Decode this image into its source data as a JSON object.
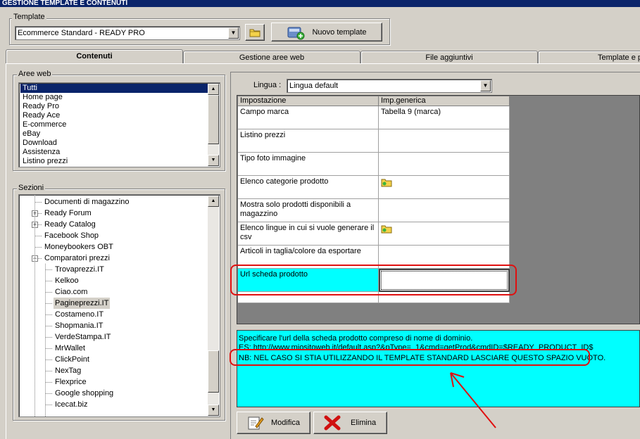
{
  "window": {
    "title": "GESTIONE TEMPLATE E CONTENUTI"
  },
  "template": {
    "group_label": "Template",
    "selected": "Ecommerce Standard - READY PRO",
    "new_button": "Nuovo template"
  },
  "tabs": [
    "Contenuti",
    "Gestione aree web",
    "File aggiuntivi",
    "Template e p"
  ],
  "aree_web": {
    "label": "Aree web",
    "items": [
      "Tutti",
      "Home page",
      "Ready Pro",
      "Ready Ace",
      "E-commerce",
      "eBay",
      "Download",
      "Assistenza",
      "Listino prezzi"
    ]
  },
  "sezioni": {
    "label": "Sezioni",
    "items": [
      {
        "label": "Documenti di magazzino",
        "expander": ""
      },
      {
        "label": "Ready Forum",
        "expander": "+"
      },
      {
        "label": "Ready Catalog",
        "expander": "+"
      },
      {
        "label": "Facebook Shop",
        "expander": ""
      },
      {
        "label": "Moneybookers OBT",
        "expander": ""
      },
      {
        "label": "Comparatori prezzi",
        "expander": "−"
      },
      {
        "label": "Trovaprezzi.IT",
        "expander": ""
      },
      {
        "label": "Kelkoo",
        "expander": ""
      },
      {
        "label": "Ciao.com",
        "expander": ""
      },
      {
        "label": "Pagineprezzi.IT",
        "expander": ""
      },
      {
        "label": "Costameno.IT",
        "expander": ""
      },
      {
        "label": "Shopmania.IT",
        "expander": ""
      },
      {
        "label": "VerdeStampa.IT",
        "expander": ""
      },
      {
        "label": "MrWallet",
        "expander": ""
      },
      {
        "label": "ClickPoint",
        "expander": ""
      },
      {
        "label": "NexTag",
        "expander": ""
      },
      {
        "label": "Flexprice",
        "expander": ""
      },
      {
        "label": "Google shopping",
        "expander": ""
      },
      {
        "label": "Icecat.biz",
        "expander": ""
      }
    ]
  },
  "lingua": {
    "label": "Lingua :",
    "selected": "Lingua default"
  },
  "grid": {
    "headers": [
      "Impostazione",
      "Imp.generica"
    ],
    "rows": [
      {
        "setting": "Campo marca",
        "value": "Tabella 9 (marca)",
        "icon": false
      },
      {
        "setting": "Listino prezzi",
        "value": "",
        "icon": false
      },
      {
        "setting": "Tipo foto immagine",
        "value": "",
        "icon": false
      },
      {
        "setting": "Elenco categorie prodotto",
        "value": "",
        "icon": true
      },
      {
        "setting": "Mostra solo prodotti disponibili a magazzino",
        "value": "",
        "icon": false
      },
      {
        "setting": "Elenco lingue in cui si vuole generare il csv",
        "value": "",
        "icon": true
      },
      {
        "setting": "Articoli in taglia/colore da esportare",
        "value": "",
        "icon": false
      },
      {
        "setting": "Url scheda prodotto",
        "value": "",
        "icon": false
      }
    ]
  },
  "description": {
    "line1": "Specificare l'url della scheda prodotto compreso di nome di dominio.",
    "line2": "ES: http://www.miositoweb.it/default.asp?&pType=_1&cmd=getProd&cmdID=$READY_PRODUCT_ID$",
    "line3": "NB: NEL CASO SI STIA UTILIZZANDO IL TEMPLATE STANDARD LASCIARE QUESTO SPAZIO VUOTO."
  },
  "buttons": {
    "modifica": "Modifica",
    "elimina": "Elimina"
  },
  "colors": {
    "highlight": "#00ffff",
    "annotation": "#e01010",
    "selection": "#0a246a"
  }
}
